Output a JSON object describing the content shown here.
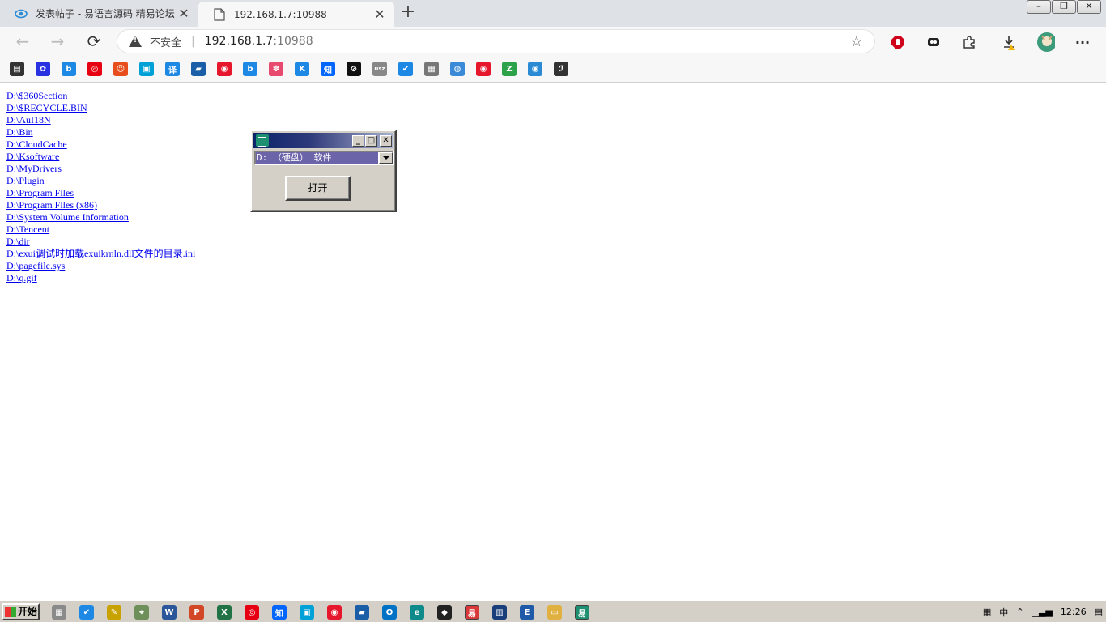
{
  "browser": {
    "tabs": [
      {
        "title": "发表帖子 - 易语言源码 精易论坛",
        "close": "✕"
      },
      {
        "title": "192.168.1.7:10988",
        "close": "✕"
      }
    ],
    "new_tab": "+",
    "window_controls": {
      "minimize": "–",
      "restore": "❐",
      "close": "✕"
    },
    "nav": {
      "back": "←",
      "forward": "→",
      "refresh": "⟳"
    },
    "address": {
      "security_label": "不安全",
      "separator": "|",
      "host": "192.168.1.7",
      "port": ":10988"
    },
    "favorite_icon": "☆",
    "extensions": [
      "stop-ext-icon",
      "tools-ext-icon",
      "puzzle-icon",
      "download-icon",
      "profile-avatar",
      "more-menu-icon"
    ],
    "more_label": "···",
    "bookmarks": [
      {
        "name": "bookmark-apps-icon",
        "glyph": "▤",
        "color": "#333333"
      },
      {
        "name": "bookmark-baidu-icon",
        "glyph": "✿",
        "color": "#2932e1"
      },
      {
        "name": "bookmark-bing-icon",
        "glyph": "b",
        "color": "#1e88e5"
      },
      {
        "name": "bookmark-netease-icon",
        "glyph": "◎",
        "color": "#e60012"
      },
      {
        "name": "bookmark-game-icon",
        "glyph": "☺",
        "color": "#e84e1b"
      },
      {
        "name": "bookmark-bilibili-icon",
        "glyph": "▣",
        "color": "#00a1d6"
      },
      {
        "name": "bookmark-translate-icon",
        "glyph": "译",
        "color": "#1e88e5"
      },
      {
        "name": "bookmark-printer-icon",
        "glyph": "▰",
        "color": "#1a5ea8"
      },
      {
        "name": "bookmark-weibo-icon",
        "glyph": "◉",
        "color": "#e6162d"
      },
      {
        "name": "bookmark-bing2-icon",
        "glyph": "b",
        "color": "#1e88e5"
      },
      {
        "name": "bookmark-flower-icon",
        "glyph": "✽",
        "color": "#e84a6f"
      },
      {
        "name": "bookmark-k-icon",
        "glyph": "K",
        "color": "#1e88e5"
      },
      {
        "name": "bookmark-zhihu-icon",
        "glyph": "知",
        "color": "#0066ff"
      },
      {
        "name": "bookmark-noentry-icon",
        "glyph": "⊘",
        "color": "#111111"
      },
      {
        "name": "bookmark-usz-icon",
        "glyph": "usz",
        "color": "#888888"
      },
      {
        "name": "bookmark-check-icon",
        "glyph": "✔",
        "color": "#1e88e5"
      },
      {
        "name": "bookmark-doc-icon",
        "glyph": "▦",
        "color": "#777777"
      },
      {
        "name": "bookmark-globe-icon",
        "glyph": "◍",
        "color": "#3b8ad8"
      },
      {
        "name": "bookmark-weibo2-icon",
        "glyph": "◉",
        "color": "#e6162d"
      },
      {
        "name": "bookmark-z-icon",
        "glyph": "Z",
        "color": "#2ca24b"
      },
      {
        "name": "bookmark-eye-icon",
        "glyph": "◉",
        "color": "#2a8bd4"
      },
      {
        "name": "bookmark-script-icon",
        "glyph": "ℐ",
        "color": "#333333"
      }
    ]
  },
  "page": {
    "files": [
      "D:\\$360Section",
      "D:\\$RECYCLE.BIN",
      "D:\\AuI18N",
      "D:\\Bin",
      "D:\\CloudCache",
      "D:\\Ksoftware",
      "D:\\MyDrivers",
      "D:\\Plugin",
      "D:\\Program Files",
      "D:\\Program Files (x86)",
      "D:\\System Volume Information",
      "D:\\Tencent",
      "D:\\dir",
      "D:\\exui调试时加载exuikrnln.dll文件的目录.ini",
      "D:\\pagefile.sys",
      "D:\\q.gif"
    ]
  },
  "dialog": {
    "min": "_",
    "max": "□",
    "close": "✕",
    "drive_value": "D: （硬盘） 软件",
    "open_label": "打开"
  },
  "taskbar": {
    "start_label": "开始",
    "apps": [
      {
        "name": "taskbar-docs-icon",
        "glyph": "▦",
        "color": "#8a8a8a"
      },
      {
        "name": "taskbar-check-icon",
        "glyph": "✔",
        "color": "#1e88e5"
      },
      {
        "name": "taskbar-notepad-icon",
        "glyph": "✎",
        "color": "#c8a200"
      },
      {
        "name": "taskbar-map-icon",
        "glyph": "⌖",
        "color": "#6f8f5a"
      },
      {
        "name": "taskbar-word-icon",
        "glyph": "W",
        "color": "#2b579a"
      },
      {
        "name": "taskbar-ppt-icon",
        "glyph": "P",
        "color": "#d24726"
      },
      {
        "name": "taskbar-excel-icon",
        "glyph": "X",
        "color": "#217346"
      },
      {
        "name": "taskbar-netease-icon",
        "glyph": "◎",
        "color": "#e60012"
      },
      {
        "name": "taskbar-zhihu-icon",
        "glyph": "知",
        "color": "#0066ff"
      },
      {
        "name": "taskbar-bilibili-icon",
        "glyph": "▣",
        "color": "#00a1d6"
      },
      {
        "name": "taskbar-weibo-icon",
        "glyph": "◉",
        "color": "#e6162d"
      },
      {
        "name": "taskbar-printer-icon",
        "glyph": "▰",
        "color": "#1a5ea8"
      },
      {
        "name": "taskbar-outlook-icon",
        "glyph": "O",
        "color": "#0072c6"
      },
      {
        "name": "taskbar-edge-icon",
        "glyph": "e",
        "color": "#0f8a8a"
      },
      {
        "name": "taskbar-inkscape-icon",
        "glyph": "◆",
        "color": "#222222"
      },
      {
        "name": "taskbar-eyuyan-icon",
        "glyph": "易",
        "color": "#d9383a"
      },
      {
        "name": "taskbar-monitor-icon",
        "glyph": "▥",
        "color": "#1a3e7a"
      },
      {
        "name": "taskbar-e-icon",
        "glyph": "E",
        "color": "#1e5aa8"
      },
      {
        "name": "taskbar-folder-icon",
        "glyph": "▭",
        "color": "#e0b040"
      },
      {
        "name": "taskbar-app-icon",
        "glyph": "易",
        "color": "#1e8f70"
      }
    ],
    "tray": {
      "input_method": "中",
      "chevron": "⌃",
      "signal": "▁▃▅",
      "time": "12:26"
    }
  }
}
